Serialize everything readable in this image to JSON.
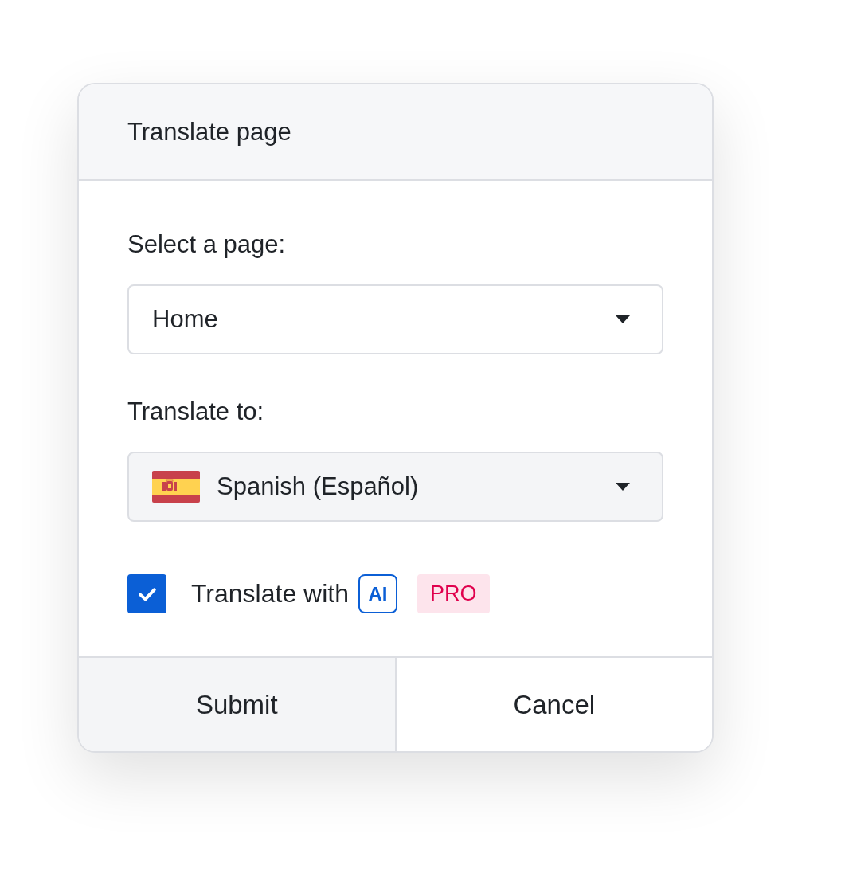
{
  "dialog": {
    "title": "Translate page"
  },
  "fields": [
    {
      "label": "Select a page:",
      "value": "Home",
      "kind": "plain"
    },
    {
      "label": "Translate to:",
      "value": "Spanish (Español)",
      "kind": "language"
    }
  ],
  "ai_option": {
    "label": "Translate with",
    "checked": true,
    "ai_badge": "AI",
    "plan_badge": "PRO"
  },
  "buttons": [
    {
      "label": "Submit",
      "kind": "filled"
    },
    {
      "label": "Cancel",
      "kind": "plain"
    }
  ]
}
